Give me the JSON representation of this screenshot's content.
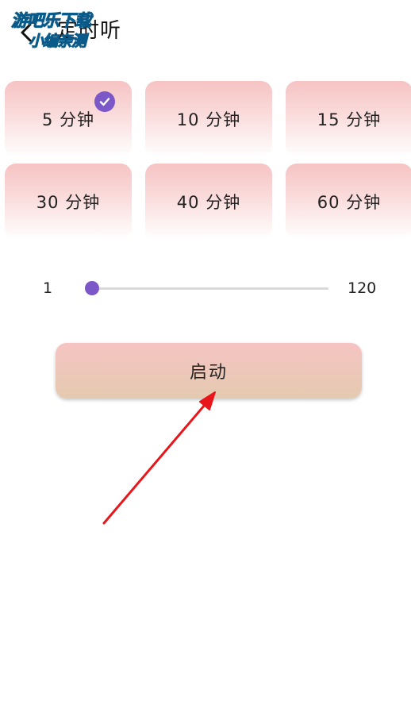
{
  "header": {
    "title": "定时听",
    "back_icon": "chevron-left-icon"
  },
  "watermark": {
    "line1": "游吧乐下载",
    "line2": "小编亲测"
  },
  "timer_options": [
    {
      "label": "5 分钟",
      "selected": true
    },
    {
      "label": "10 分钟",
      "selected": false
    },
    {
      "label": "15 分钟",
      "selected": false
    },
    {
      "label": "30 分钟",
      "selected": false
    },
    {
      "label": "40 分钟",
      "selected": false
    },
    {
      "label": "60 分钟",
      "selected": false
    }
  ],
  "slider": {
    "min_label": "1",
    "max_label": "120",
    "min": 1,
    "max": 120,
    "value": 1
  },
  "start_button": {
    "label": "启动"
  },
  "colors": {
    "accent": "#7b57c8",
    "tile_top": "#f6c3c3",
    "button_top": "#f6c4c3",
    "button_bottom": "#e4cab0",
    "arrow": "#e8161b"
  }
}
